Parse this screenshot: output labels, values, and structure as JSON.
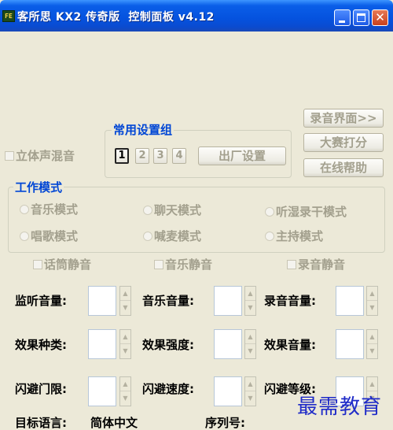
{
  "window": {
    "icon_text": "FE",
    "title": "客所思 KX2 传奇版  控制面板 v4.12",
    "close_glyph": "✕"
  },
  "buttons": {
    "recording_ui": "录音界面>>",
    "contest_score": "大赛打分",
    "online_help": "在线帮助",
    "factory_settings": "出厂设置"
  },
  "stereo_mix": {
    "label": "立体声混音",
    "checked": false
  },
  "presets": {
    "title": "常用设置组",
    "items": [
      "1",
      "2",
      "3",
      "4"
    ],
    "active": "1"
  },
  "work_mode": {
    "title": "工作模式",
    "modes": [
      "音乐模式",
      "聊天模式",
      "听湿录干模式",
      "唱歌模式",
      "喊麦模式",
      "主持模式"
    ]
  },
  "mutes": {
    "mic": "话筒静音",
    "music": "音乐静音",
    "record": "录音静音"
  },
  "controls": {
    "monitor_volume": "监听音量:",
    "music_volume": "音乐音量:",
    "record_volume": "录音音量:",
    "effect_type": "效果种类:",
    "effect_strength": "效果强度:",
    "effect_volume": "效果音量:",
    "ducking_threshold": "闪避门限:",
    "ducking_speed": "闪避速度:",
    "ducking_level": "闪避等级:"
  },
  "footer": {
    "target_language_label": "目标语言:",
    "target_language_value": "简体中文",
    "serial_label": "序列号:"
  },
  "watermark": "最需教育"
}
